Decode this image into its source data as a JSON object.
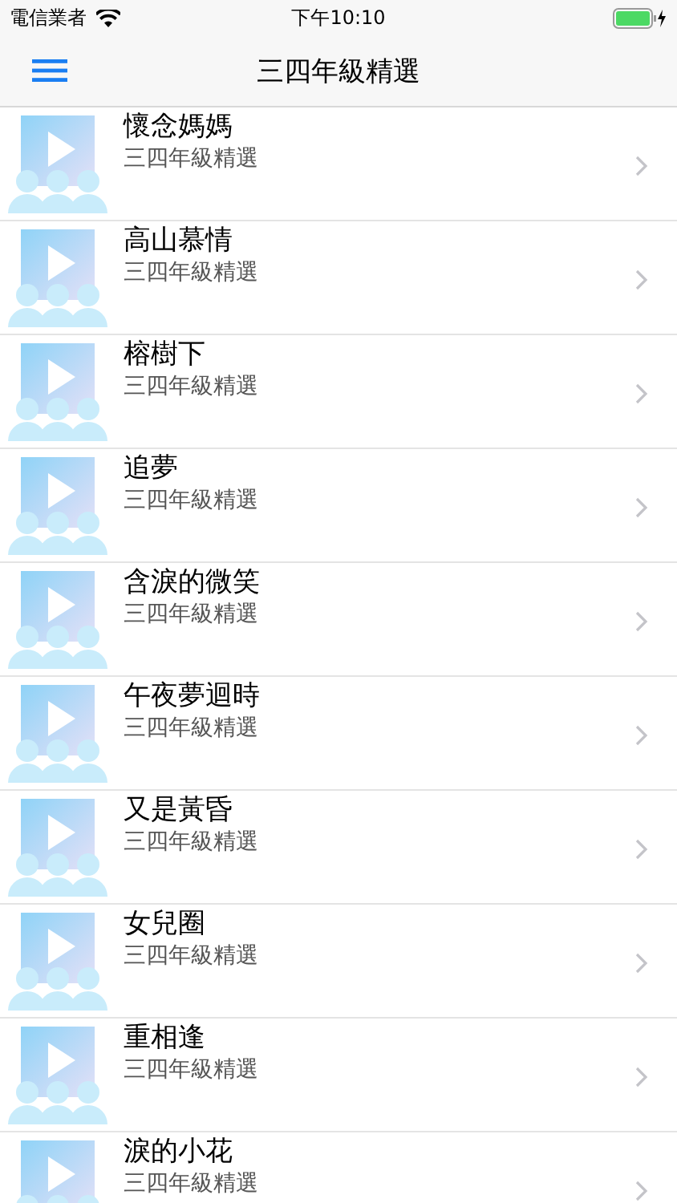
{
  "status_bar": {
    "carrier": "電信業者",
    "time": "下午10:10"
  },
  "nav_bar": {
    "title": "三四年級精選"
  },
  "list": [
    {
      "title": "懷念媽媽",
      "subtitle": "三四年級精選"
    },
    {
      "title": "高山慕情",
      "subtitle": "三四年級精選"
    },
    {
      "title": "榕樹下",
      "subtitle": "三四年級精選"
    },
    {
      "title": "追夢",
      "subtitle": "三四年級精選"
    },
    {
      "title": "含淚的微笑",
      "subtitle": "三四年級精選"
    },
    {
      "title": "午夜夢迴時",
      "subtitle": "三四年級精選"
    },
    {
      "title": "又是黃昏",
      "subtitle": "三四年級精選"
    },
    {
      "title": "女兒圈",
      "subtitle": "三四年級精選"
    },
    {
      "title": "重相逢",
      "subtitle": "三四年級精選"
    },
    {
      "title": "淚的小花",
      "subtitle": "三四年級精選"
    }
  ]
}
